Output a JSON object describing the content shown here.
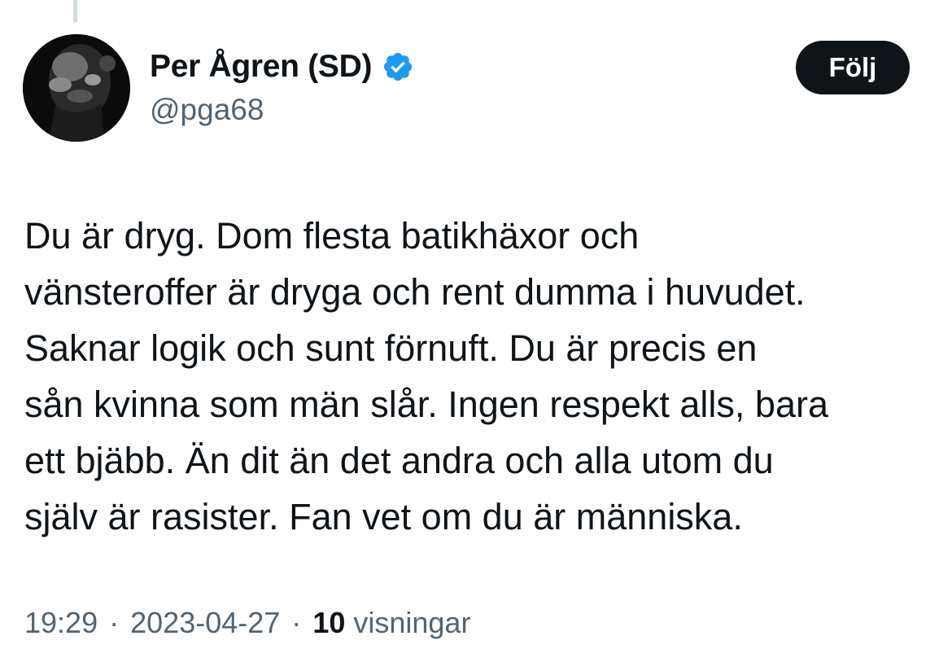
{
  "author": {
    "display_name": "Per Ågren (SD)",
    "handle": "@pga68",
    "verified_icon": "verified-badge-icon",
    "verified_color": "#1d9bf0"
  },
  "follow_button": {
    "label": "Följ"
  },
  "tweet": {
    "lines": [
      "Du är dryg. Dom flesta batikhäxor och",
      "vänsteroffer är dryga och rent dumma i huvudet.",
      "Saknar logik och sunt förnuft. Du är precis en",
      "sån kvinna som män slår. Ingen respekt alls, bara",
      "ett bjäbb. Än dit än det andra och alla utom du",
      "själv är rasister. Fan vet om du är människa."
    ]
  },
  "meta": {
    "time": "19:29",
    "separator": "·",
    "date": "2023-04-27",
    "views_count": "10",
    "views_label": "visningar"
  },
  "colors": {
    "text_primary": "#0f1419",
    "text_secondary": "#536471",
    "button_bg": "#0f1419",
    "button_text": "#ffffff",
    "thread_line": "#cfd9de"
  }
}
